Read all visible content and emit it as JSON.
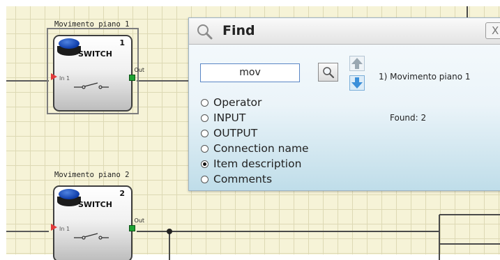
{
  "canvas": {
    "blocks": [
      {
        "title": "Movimento piano 1",
        "type_label": "SWITCH",
        "number": "1",
        "input_label": "In 1",
        "output_label": "Out",
        "selected": true
      },
      {
        "title": "Movimento piano 2",
        "type_label": "SWITCH",
        "number": "2",
        "input_label": "In 1",
        "output_label": "Out",
        "selected": false
      }
    ]
  },
  "find_dialog": {
    "title": "Find",
    "close_symbol": "X",
    "search_value": "mov",
    "icons": {
      "title": "magnifier-icon",
      "search": "search-icon",
      "prev": "arrow-up-icon",
      "next": "arrow-down-icon"
    },
    "result": "1) Movimento piano 1",
    "found_text": "Found: 2",
    "options": [
      {
        "label": "Operator",
        "checked": false
      },
      {
        "label": "INPUT",
        "checked": false
      },
      {
        "label": "OUTPUT",
        "checked": false
      },
      {
        "label": "Connection name",
        "checked": false
      },
      {
        "label": "Item description",
        "checked": true
      },
      {
        "label": "Comments",
        "checked": false
      }
    ]
  },
  "colors": {
    "grid": "#f6f3d7",
    "dialog_gradient_bottom": "#bfdde9",
    "output_pin": "#1fa334",
    "input_pin": "#e23b3b",
    "arrow": "#3b8fd9"
  }
}
